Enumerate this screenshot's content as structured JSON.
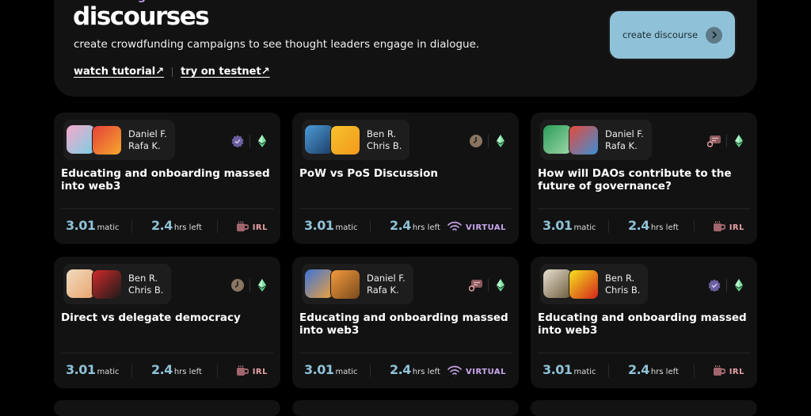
{
  "hero": {
    "kicker": "introducing",
    "title": "discourses",
    "subtitle": "create crowdfunding campaigns to see thought leaders engage in dialogue.",
    "watch_tutorial": "watch tutorial↗",
    "try_testnet": "try on testnet↗",
    "create_button": "create discourse"
  },
  "colors": {
    "accent": "#8fc2d8",
    "irl": "#e5a0a5",
    "virtual": "#c9a6ee",
    "kicker": "#c29cf0"
  },
  "cards": [
    {
      "speaker1": "Daniel F.",
      "speaker2": "Rafa K.",
      "badge": "verified-icon",
      "title": "Educating and onboarding massed into web3",
      "amount": "3.01",
      "amount_unit": "matic",
      "time": "2.4",
      "time_unit": "hrs left",
      "venue": "IRL"
    },
    {
      "speaker1": "Ben R.",
      "speaker2": "Chris B.",
      "badge": "clock-icon",
      "title": "PoW vs PoS Discussion",
      "amount": "3.01",
      "amount_unit": "matic",
      "time": "2.4",
      "time_unit": "hrs left",
      "venue": "VIRTUAL"
    },
    {
      "speaker1": "Daniel F.",
      "speaker2": "Rafa K.",
      "badge": "chat-icon",
      "title": "How will DAOs contribute to the future of governance?",
      "amount": "3.01",
      "amount_unit": "matic",
      "time": "2.4",
      "time_unit": "hrs left",
      "venue": "IRL"
    },
    {
      "speaker1": "Ben R.",
      "speaker2": "Chris B.",
      "badge": "clock-icon",
      "title": "Direct vs delegate democracy",
      "amount": "3.01",
      "amount_unit": "matic",
      "time": "2.4",
      "time_unit": "hrs left",
      "venue": "IRL"
    },
    {
      "speaker1": "Daniel F.",
      "speaker2": "Rafa K.",
      "badge": "chat-icon",
      "title": "Educating and onboarding massed into web3",
      "amount": "3.01",
      "amount_unit": "matic",
      "time": "2.4",
      "time_unit": "hrs left",
      "venue": "VIRTUAL"
    },
    {
      "speaker1": "Ben R.",
      "speaker2": "Chris B.",
      "badge": "verified-icon",
      "title": "Educating and onboarding massed into web3",
      "amount": "3.01",
      "amount_unit": "matic",
      "time": "2.4",
      "time_unit": "hrs left",
      "venue": "IRL"
    }
  ]
}
